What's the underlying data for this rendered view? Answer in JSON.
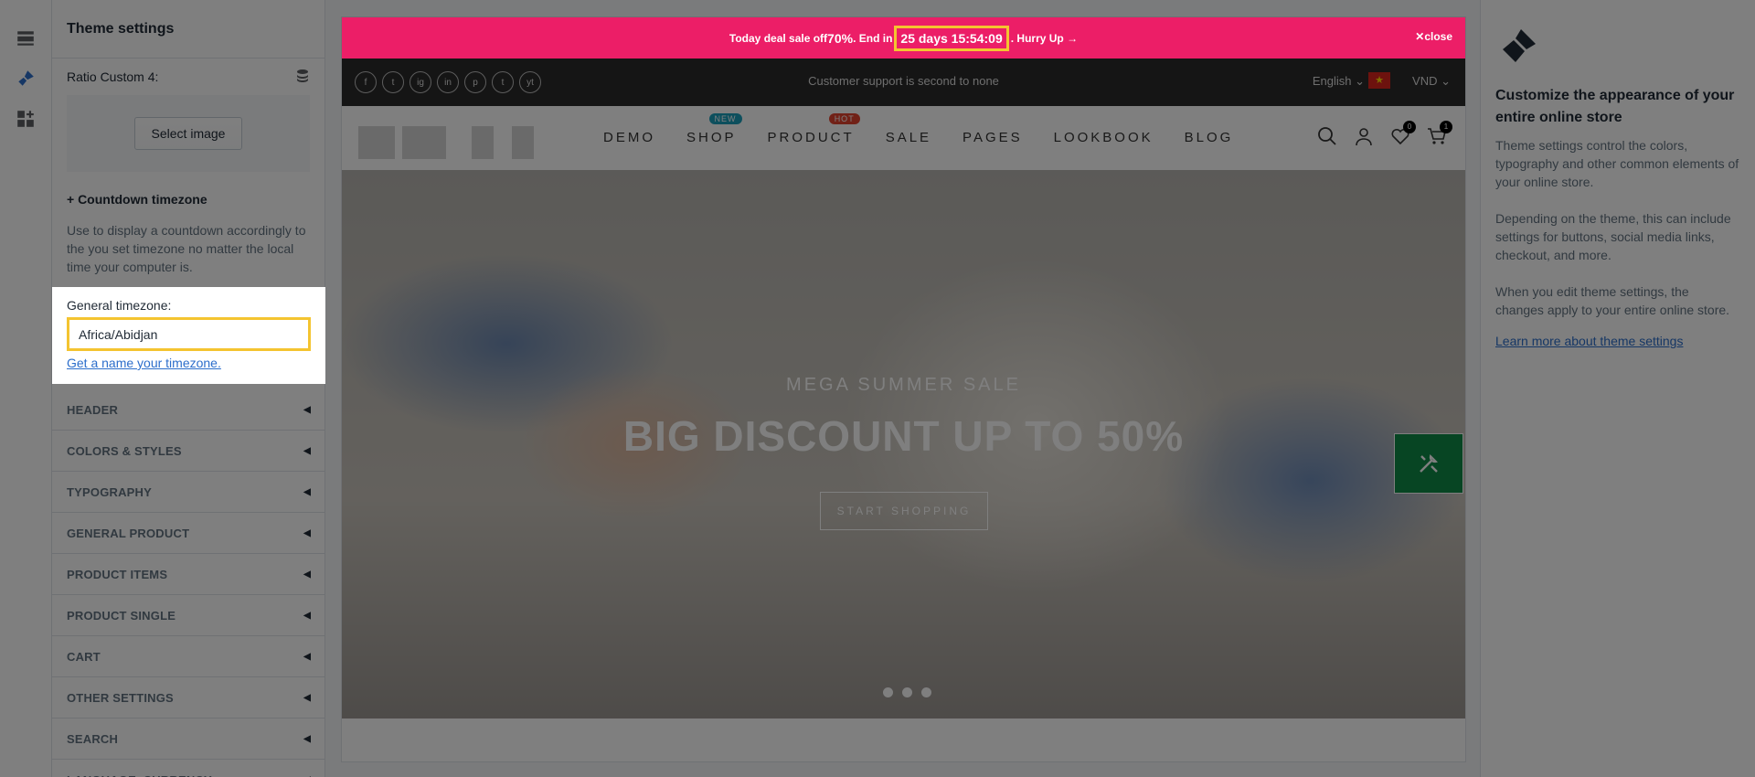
{
  "rail": {
    "icons": [
      "sections-icon",
      "theme-brush-icon",
      "add-apps-icon"
    ]
  },
  "sidebar": {
    "title": "Theme settings",
    "ratio_label": "Ratio Custom 4:",
    "select_image": "Select image",
    "countdown_heading": "+ Countdown timezone",
    "countdown_desc": "Use to display a countdown accordingly to the you set timezone no matter the local time your computer is.",
    "timezone_label": "General timezone:",
    "timezone_value": "Africa/Abidjan",
    "timezone_link": "Get a name your timezone.",
    "sections": [
      "HEADER",
      "COLORS & STYLES",
      "TYPOGRAPHY",
      "GENERAL PRODUCT",
      "PRODUCT ITEMS",
      "PRODUCT SINGLE",
      "CART",
      "OTHER SETTINGS",
      "SEARCH",
      "LANGUAGE, CURRENCY"
    ]
  },
  "preview": {
    "promo": {
      "prefix": "Today deal sale off ",
      "discount": "70%",
      "mid": ". End in ",
      "countdown": "25 days 15:54:09",
      "suffix": ". Hurry Up →",
      "close": "close"
    },
    "topbar": {
      "socials": [
        "f",
        "t",
        "ig",
        "in",
        "p",
        "t",
        "yt"
      ],
      "support": "Customer support is second to none",
      "language": "English",
      "flag": "★",
      "currency": "VND"
    },
    "menu": [
      {
        "label": "DEMO",
        "badge": ""
      },
      {
        "label": "SHOP",
        "badge": "NEW",
        "badge_color": "#1a9fbb"
      },
      {
        "label": "PRODUCT",
        "badge": "HOT",
        "badge_color": "#e2422f"
      },
      {
        "label": "SALE",
        "badge": ""
      },
      {
        "label": "PAGES",
        "badge": ""
      },
      {
        "label": "LOOKBOOK",
        "badge": ""
      },
      {
        "label": "BLOG",
        "badge": ""
      }
    ],
    "wishlist_count": "0",
    "cart_count": "1",
    "hero": {
      "subtitle": "MEGA SUMMER SALE",
      "title": "BIG DISCOUNT UP TO 50%",
      "button": "START SHOPPING",
      "slides": 3
    }
  },
  "info": {
    "title": "Customize the appearance of your entire online store",
    "p1": "Theme settings control the colors, typography and other common elements of your online store.",
    "p2": "Depending on the theme, this can include settings for buttons, social media links, checkout, and more.",
    "p3": "When you edit theme settings, the changes apply to your entire online store.",
    "link": "Learn more about theme settings"
  },
  "colors": {
    "promo_bg": "#ec1e67",
    "highlight": "#f4c430",
    "tool_button": "#0e8b47",
    "link": "#2c6ecb"
  }
}
